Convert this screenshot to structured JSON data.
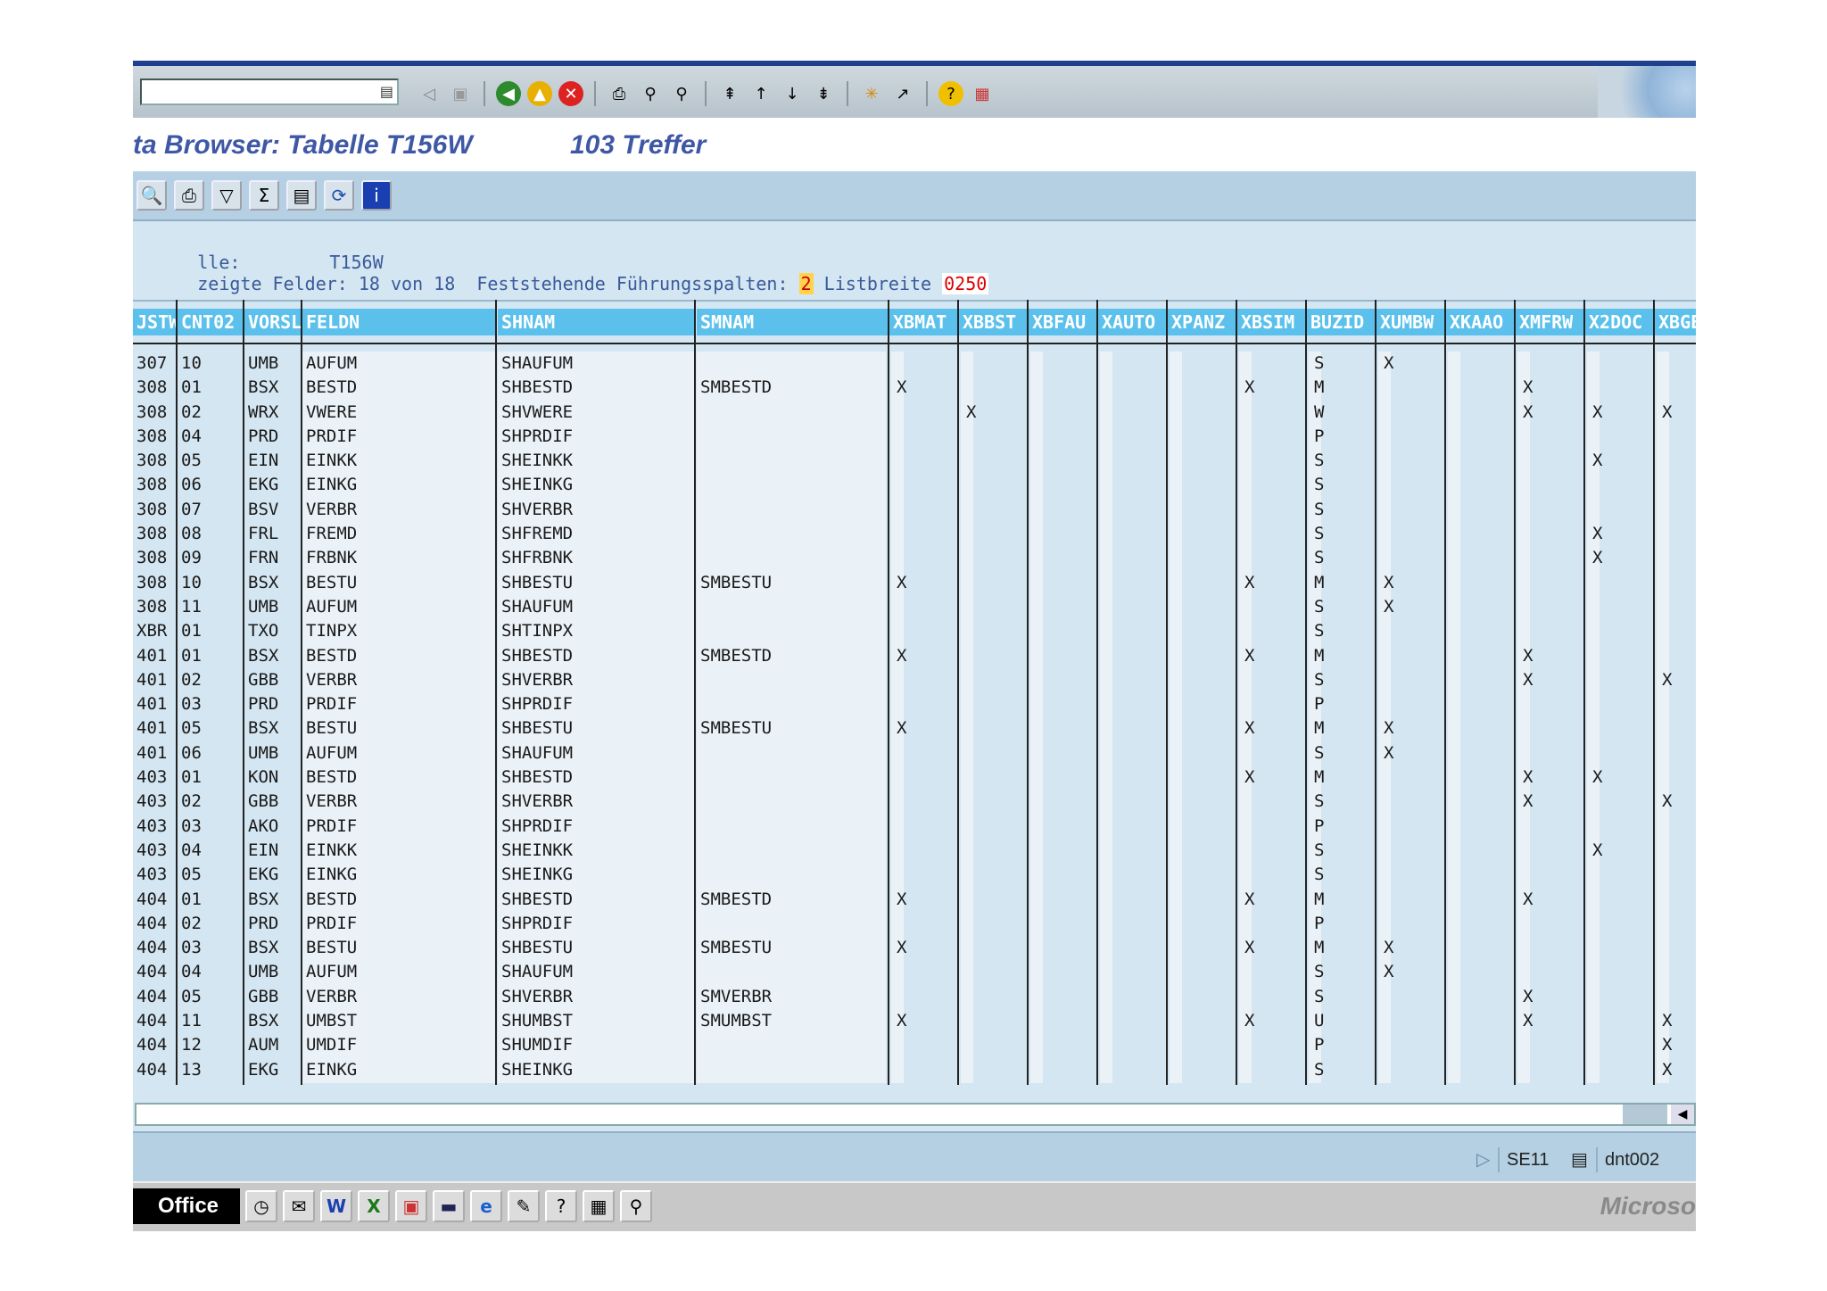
{
  "toolbar": {
    "command_field": "",
    "icons": [
      "back-arrow-icon",
      "save-icon",
      "green-back-icon",
      "exit-icon",
      "cancel-icon",
      "print-icon",
      "find-icon",
      "find-next-icon",
      "first-page-icon",
      "prev-page-icon",
      "next-page-icon",
      "last-page-icon",
      "new-session-icon",
      "shortcut-icon",
      "help-icon",
      "layout-icon"
    ]
  },
  "title": {
    "text": "ta Browser: Tabelle T156W",
    "hits": "103 Treffer"
  },
  "app_toolbar": {
    "icons": [
      "detail-icon",
      "print-icon",
      "filter-icon",
      "sum-icon",
      "layout-icon",
      "refresh-icon",
      "info-icon"
    ]
  },
  "info": {
    "line1_label": "lle:",
    "line1_value": "T156W",
    "line2_label": "zeigte Felder: 18 von 18  Feststehende Führungsspalten:",
    "line2_fixed": "2",
    "line2_label2": "Listbreite",
    "line2_width": "0250"
  },
  "columns": [
    "JSTW",
    "CNT02",
    "VORSL",
    "FELDN",
    "SHNAM",
    "SMNAM",
    "XBMAT",
    "XBBST",
    "XBFAU",
    "XAUTO",
    "XPANZ",
    "XBSIM",
    "BUZID",
    "XUMBW",
    "XKAAO",
    "XMFRW",
    "X2DOC",
    "XBGE"
  ],
  "rows": [
    [
      "307",
      "10",
      "UMB",
      "AUFUM",
      "SHAUFUM",
      "",
      "",
      "",
      "",
      "",
      "",
      "",
      "S",
      "X",
      "",
      "",
      "",
      ""
    ],
    [
      "308",
      "01",
      "BSX",
      "BESTD",
      "SHBESTD",
      "SMBESTD",
      "X",
      "",
      "",
      "",
      "",
      "X",
      "M",
      "",
      "",
      "X",
      "",
      ""
    ],
    [
      "308",
      "02",
      "WRX",
      "VWERE",
      "SHVWERE",
      "",
      "",
      "X",
      "",
      "",
      "",
      "",
      "W",
      "",
      "",
      "X",
      "X",
      "X"
    ],
    [
      "308",
      "04",
      "PRD",
      "PRDIF",
      "SHPRDIF",
      "",
      "",
      "",
      "",
      "",
      "",
      "",
      "P",
      "",
      "",
      "",
      "",
      ""
    ],
    [
      "308",
      "05",
      "EIN",
      "EINKK",
      "SHEINKK",
      "",
      "",
      "",
      "",
      "",
      "",
      "",
      "S",
      "",
      "",
      "",
      "X",
      ""
    ],
    [
      "308",
      "06",
      "EKG",
      "EINKG",
      "SHEINKG",
      "",
      "",
      "",
      "",
      "",
      "",
      "",
      "S",
      "",
      "",
      "",
      "",
      ""
    ],
    [
      "308",
      "07",
      "BSV",
      "VERBR",
      "SHVERBR",
      "",
      "",
      "",
      "",
      "",
      "",
      "",
      "S",
      "",
      "",
      "",
      "",
      ""
    ],
    [
      "308",
      "08",
      "FRL",
      "FREMD",
      "SHFREMD",
      "",
      "",
      "",
      "",
      "",
      "",
      "",
      "S",
      "",
      "",
      "",
      "X",
      ""
    ],
    [
      "308",
      "09",
      "FRN",
      "FRBNK",
      "SHFRBNK",
      "",
      "",
      "",
      "",
      "",
      "",
      "",
      "S",
      "",
      "",
      "",
      "X",
      ""
    ],
    [
      "308",
      "10",
      "BSX",
      "BESTU",
      "SHBESTU",
      "SMBESTU",
      "X",
      "",
      "",
      "",
      "",
      "X",
      "M",
      "X",
      "",
      "",
      "",
      ""
    ],
    [
      "308",
      "11",
      "UMB",
      "AUFUM",
      "SHAUFUM",
      "",
      "",
      "",
      "",
      "",
      "",
      "",
      "S",
      "X",
      "",
      "",
      "",
      ""
    ],
    [
      "XBR",
      "01",
      "TXO",
      "TINPX",
      "SHTINPX",
      "",
      "",
      "",
      "",
      "",
      "",
      "",
      "S",
      "",
      "",
      "",
      "",
      ""
    ],
    [
      "401",
      "01",
      "BSX",
      "BESTD",
      "SHBESTD",
      "SMBESTD",
      "X",
      "",
      "",
      "",
      "",
      "X",
      "M",
      "",
      "",
      "X",
      "",
      ""
    ],
    [
      "401",
      "02",
      "GBB",
      "VERBR",
      "SHVERBR",
      "",
      "",
      "",
      "",
      "",
      "",
      "",
      "S",
      "",
      "",
      "X",
      "",
      "X"
    ],
    [
      "401",
      "03",
      "PRD",
      "PRDIF",
      "SHPRDIF",
      "",
      "",
      "",
      "",
      "",
      "",
      "",
      "P",
      "",
      "",
      "",
      "",
      ""
    ],
    [
      "401",
      "05",
      "BSX",
      "BESTU",
      "SHBESTU",
      "SMBESTU",
      "X",
      "",
      "",
      "",
      "",
      "X",
      "M",
      "X",
      "",
      "",
      "",
      ""
    ],
    [
      "401",
      "06",
      "UMB",
      "AUFUM",
      "SHAUFUM",
      "",
      "",
      "",
      "",
      "",
      "",
      "",
      "S",
      "X",
      "",
      "",
      "",
      ""
    ],
    [
      "403",
      "01",
      "KON",
      "BESTD",
      "SHBESTD",
      "",
      "",
      "",
      "",
      "",
      "",
      "X",
      "M",
      "",
      "",
      "X",
      "X",
      ""
    ],
    [
      "403",
      "02",
      "GBB",
      "VERBR",
      "SHVERBR",
      "",
      "",
      "",
      "",
      "",
      "",
      "",
      "S",
      "",
      "",
      "X",
      "",
      "X"
    ],
    [
      "403",
      "03",
      "AKO",
      "PRDIF",
      "SHPRDIF",
      "",
      "",
      "",
      "",
      "",
      "",
      "",
      "P",
      "",
      "",
      "",
      "",
      ""
    ],
    [
      "403",
      "04",
      "EIN",
      "EINKK",
      "SHEINKK",
      "",
      "",
      "",
      "",
      "",
      "",
      "",
      "S",
      "",
      "",
      "",
      "X",
      ""
    ],
    [
      "403",
      "05",
      "EKG",
      "EINKG",
      "SHEINKG",
      "",
      "",
      "",
      "",
      "",
      "",
      "",
      "S",
      "",
      "",
      "",
      "",
      ""
    ],
    [
      "404",
      "01",
      "BSX",
      "BESTD",
      "SHBESTD",
      "SMBESTD",
      "X",
      "",
      "",
      "",
      "",
      "X",
      "M",
      "",
      "",
      "X",
      "",
      ""
    ],
    [
      "404",
      "02",
      "PRD",
      "PRDIF",
      "SHPRDIF",
      "",
      "",
      "",
      "",
      "",
      "",
      "",
      "P",
      "",
      "",
      "",
      "",
      ""
    ],
    [
      "404",
      "03",
      "BSX",
      "BESTU",
      "SHBESTU",
      "SMBESTU",
      "X",
      "",
      "",
      "",
      "",
      "X",
      "M",
      "X",
      "",
      "",
      "",
      ""
    ],
    [
      "404",
      "04",
      "UMB",
      "AUFUM",
      "SHAUFUM",
      "",
      "",
      "",
      "",
      "",
      "",
      "",
      "S",
      "X",
      "",
      "",
      "",
      ""
    ],
    [
      "404",
      "05",
      "GBB",
      "VERBR",
      "SHVERBR",
      "SMVERBR",
      "",
      "",
      "",
      "",
      "",
      "",
      "S",
      "",
      "",
      "X",
      "",
      ""
    ],
    [
      "404",
      "11",
      "BSX",
      "UMBST",
      "SHUMBST",
      "SMUMBST",
      "X",
      "",
      "",
      "",
      "",
      "X",
      "U",
      "",
      "",
      "X",
      "",
      "X"
    ],
    [
      "404",
      "12",
      "AUM",
      "UMDIF",
      "SHUMDIF",
      "",
      "",
      "",
      "",
      "",
      "",
      "",
      "P",
      "",
      "",
      "",
      "",
      "X"
    ],
    [
      "404",
      "13",
      "EKG",
      "EINKG",
      "SHEINKG",
      "",
      "",
      "",
      "",
      "",
      "",
      "",
      "S",
      "",
      "",
      "",
      "",
      "X"
    ]
  ],
  "status": {
    "transaction": "SE11",
    "server": "dnt002"
  },
  "taskbar": {
    "start_label": "Office",
    "right_text": "Microso"
  }
}
